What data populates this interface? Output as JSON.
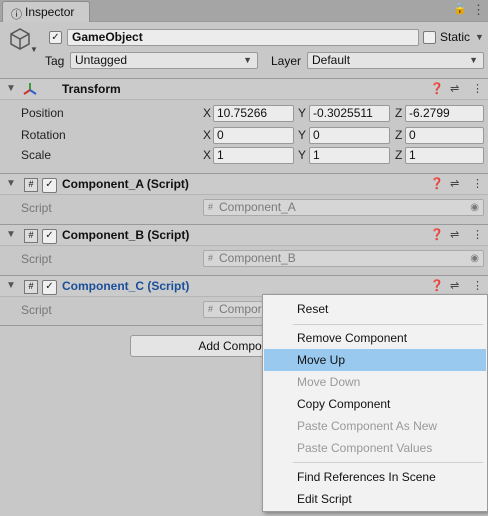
{
  "tab": {
    "label": "Inspector",
    "icon": "info-icon"
  },
  "header": {
    "object_name": "GameObject",
    "static_label": "Static",
    "tag_label": "Tag",
    "tag_value": "Untagged",
    "layer_label": "Layer",
    "layer_value": "Default"
  },
  "transform": {
    "title": "Transform",
    "position_label": "Position",
    "rotation_label": "Rotation",
    "scale_label": "Scale",
    "axis_x": "X",
    "axis_y": "Y",
    "axis_z": "Z",
    "position": [
      "10.75266",
      "-0.3025511",
      "-6.2799"
    ],
    "rotation": [
      "0",
      "0",
      "0"
    ],
    "scale": [
      "1",
      "1",
      "1"
    ]
  },
  "components": [
    {
      "title": "Component_A (Script)",
      "script_label": "Script",
      "script_value": "Component_A"
    },
    {
      "title": "Component_B (Script)",
      "script_label": "Script",
      "script_value": "Component_B"
    },
    {
      "title": "Component_C (Script)",
      "script_label": "Script",
      "script_value": "Compor"
    }
  ],
  "add_component_label": "Add Compo",
  "context_menu": {
    "items": [
      {
        "label": "Reset",
        "enabled": true
      },
      {
        "label": "Remove Component",
        "enabled": true
      },
      {
        "label": "Move Up",
        "enabled": true,
        "highlighted": true
      },
      {
        "label": "Move Down",
        "enabled": false
      },
      {
        "label": "Copy Component",
        "enabled": true
      },
      {
        "label": "Paste Component As New",
        "enabled": false
      },
      {
        "label": "Paste Component Values",
        "enabled": false
      },
      {
        "label": "Find References In Scene",
        "enabled": true
      },
      {
        "label": "Edit Script",
        "enabled": true
      }
    ]
  },
  "colors": {
    "panel_bg": "#c8c8c8",
    "selected_title": "#1a4f9a",
    "menu_highlight": "#99c9ef"
  }
}
